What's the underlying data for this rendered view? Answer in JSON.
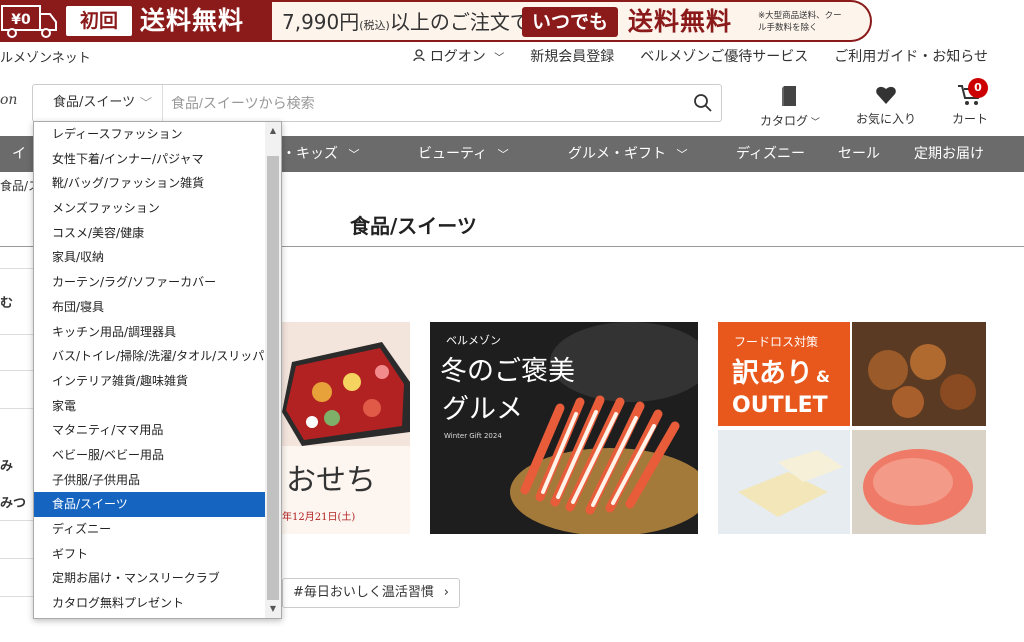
{
  "promo": {
    "shipping_zero": "¥0",
    "first_time": "初回",
    "free_shipping": "送料無料",
    "price": "7,990円",
    "tax": "(税込)",
    "above_order": "以上のご注文で",
    "anytime": "いつでも",
    "free_shipping2": "送料無料",
    "fine_print": "※大型商品送料、クール手数料を除く"
  },
  "header": {
    "brand": "ルメゾンネット",
    "logo_fragment": "on",
    "links": [
      "ログオン",
      "新規会員登録",
      "ベルメゾンご優待サービス",
      "ご利用ガイド・お知らせ"
    ]
  },
  "search": {
    "category": "食品/スイーツ",
    "placeholder": "食品/スイーツから検索"
  },
  "icons": {
    "catalog": "カタログ",
    "favorites": "お気に入り",
    "cart": "カート",
    "cart_count": "0"
  },
  "nav": {
    "items": [
      "イ",
      "・キッズ",
      "ビューティ",
      "グルメ・ギフト",
      "ディズニー",
      "セール",
      "定期お届け"
    ]
  },
  "breadcrumb": "食品/ス",
  "page_title": "食品/スイーツ",
  "sidebar_fragments": [
    "む",
    "み",
    "みつ"
  ],
  "banners": {
    "osechi": "おせち",
    "osechi_date": "年12月21日(土)",
    "gourmet_brand": "ベルメゾン",
    "gourmet_title_1": "冬のご褒美",
    "gourmet_title_2": "グルメ",
    "gourmet_sub": "Winter Gift 2024",
    "outlet_top": "フードロス対策",
    "outlet_wakeari": "訳あり",
    "outlet_and": "&",
    "outlet_outlet": "OUTLET"
  },
  "tag_button": "#毎日おいしく温活習慣",
  "dropdown": {
    "options": [
      "レディースファッション",
      "女性下着/インナー/パジャマ",
      "靴/バッグ/ファッション雑貨",
      "メンズファッション",
      "コスメ/美容/健康",
      "家具/収納",
      "カーテン/ラグ/ソファーカバー",
      "布団/寝具",
      "キッチン用品/調理器具",
      "バス/トイレ/掃除/洗濯/タオル/スリッパ",
      "インテリア雑貨/趣味雑貨",
      "家電",
      "マタニティ/ママ用品",
      "ベビー服/ベビー用品",
      "子供服/子供用品",
      "食品/スイーツ",
      "ディズニー",
      "ギフト",
      "定期お届け・マンスリークラブ",
      "カタログ無料プレゼント"
    ],
    "selected_index": 15
  },
  "colors": {
    "brand_red": "#8b1a1a",
    "nav_gray": "#6b6b6b",
    "selected_blue": "#1565c0"
  }
}
